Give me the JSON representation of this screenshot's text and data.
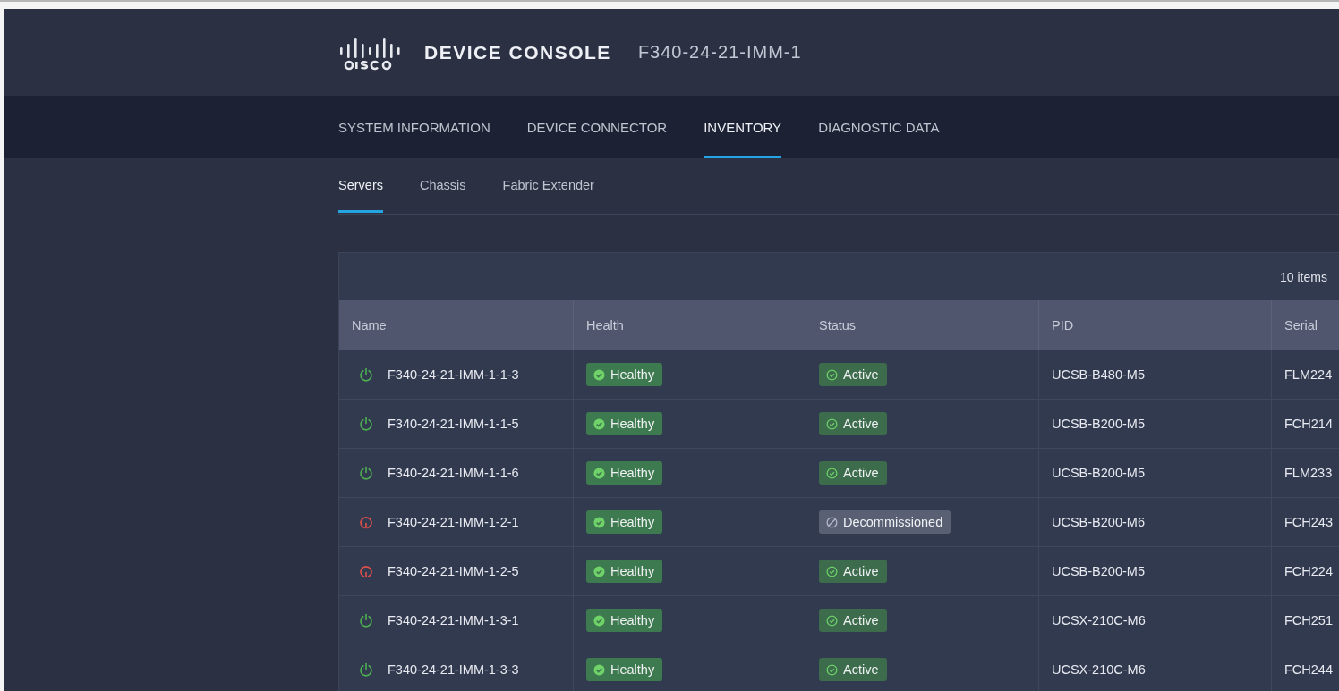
{
  "header": {
    "brand": "DEVICE CONSOLE",
    "device": "F340-24-21-IMM-1"
  },
  "tabs": [
    {
      "label": "SYSTEM INFORMATION",
      "selected": false
    },
    {
      "label": "DEVICE CONNECTOR",
      "selected": false
    },
    {
      "label": "INVENTORY",
      "selected": true
    },
    {
      "label": "DIAGNOSTIC DATA",
      "selected": false
    }
  ],
  "subtabs": [
    {
      "label": "Servers",
      "selected": true
    },
    {
      "label": "Chassis",
      "selected": false
    },
    {
      "label": "Fabric Extender",
      "selected": false
    }
  ],
  "table": {
    "count": "10 items",
    "columns": [
      "Name",
      "Health",
      "Status",
      "PID",
      "Serial"
    ],
    "rows": [
      {
        "powered": true,
        "name": "F340-24-21-IMM-1-1-3",
        "health": "Healthy",
        "decommissioned": false,
        "status": "Active",
        "pid": "UCSB-B480-M5",
        "serial": "FLM224"
      },
      {
        "powered": true,
        "name": "F340-24-21-IMM-1-1-5",
        "health": "Healthy",
        "decommissioned": false,
        "status": "Active",
        "pid": "UCSB-B200-M5",
        "serial": "FCH214"
      },
      {
        "powered": true,
        "name": "F340-24-21-IMM-1-1-6",
        "health": "Healthy",
        "decommissioned": false,
        "status": "Active",
        "pid": "UCSB-B200-M5",
        "serial": "FLM233"
      },
      {
        "powered": false,
        "name": "F340-24-21-IMM-1-2-1",
        "health": "Healthy",
        "decommissioned": true,
        "status": "Decommissioned",
        "pid": "UCSB-B200-M6",
        "serial": "FCH243"
      },
      {
        "powered": false,
        "name": "F340-24-21-IMM-1-2-5",
        "health": "Healthy",
        "decommissioned": false,
        "status": "Active",
        "pid": "UCSB-B200-M5",
        "serial": "FCH224"
      },
      {
        "powered": true,
        "name": "F340-24-21-IMM-1-3-1",
        "health": "Healthy",
        "decommissioned": false,
        "status": "Active",
        "pid": "UCSX-210C-M6",
        "serial": "FCH251"
      },
      {
        "powered": true,
        "name": "F340-24-21-IMM-1-3-3",
        "health": "Healthy",
        "decommissioned": false,
        "status": "Active",
        "pid": "UCSX-210C-M6",
        "serial": "FCH244"
      }
    ]
  }
}
